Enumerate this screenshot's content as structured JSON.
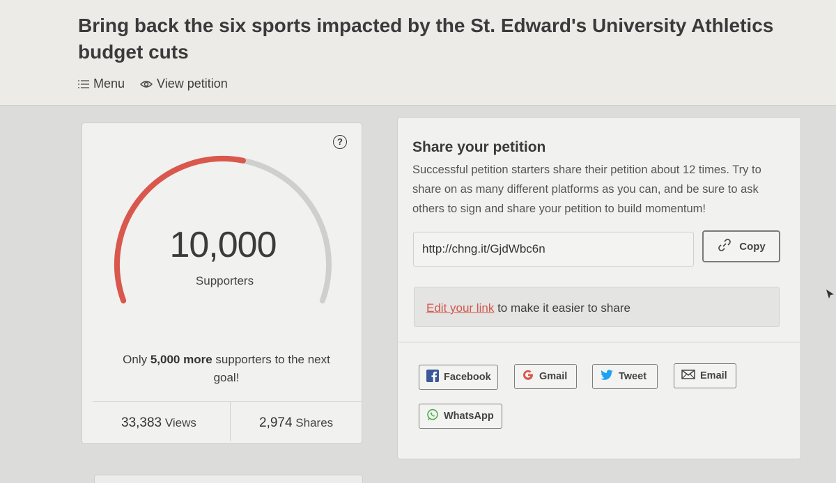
{
  "header": {
    "title": "Bring back the six sports impacted by the St. Edward's University Athletics budget cuts",
    "menu_label": "Menu",
    "view_label": "View petition"
  },
  "stats": {
    "count": "10,000",
    "count_label": "Supporters",
    "progress_fraction": 0.55,
    "goal_prefix": "Only",
    "goal_bold": "5,000 more",
    "goal_suffix": "supporters to the next goal!",
    "views_num": "33,383",
    "views_label": "Views",
    "shares_num": "2,974",
    "shares_label": "Shares",
    "help_symbol": "?"
  },
  "share": {
    "title": "Share your petition",
    "description": "Successful petition starters share their petition about 12 times. Try to share on as many different platforms as you can, and be sure to ask others to sign and share your petition to build momentum!",
    "link_value": "http://chng.it/GjdWbc6n",
    "copy_label": "Copy",
    "edit_link_label": "Edit your link",
    "edit_suffix": "to make it easier to share",
    "buttons": {
      "facebook": "Facebook",
      "gmail": "Gmail",
      "tweet": "Tweet",
      "email": "Email",
      "whatsapp": "WhatsApp"
    }
  },
  "colors": {
    "accent": "#d9574d",
    "track": "#cfcfcc",
    "facebook": "#3b5998",
    "twitter": "#1da1f2",
    "whatsapp": "#4caf50"
  },
  "icons": [
    "menu-icon",
    "eye-icon",
    "help-icon",
    "link-icon",
    "facebook-icon",
    "google-icon",
    "twitter-icon",
    "email-icon",
    "whatsapp-icon"
  ]
}
